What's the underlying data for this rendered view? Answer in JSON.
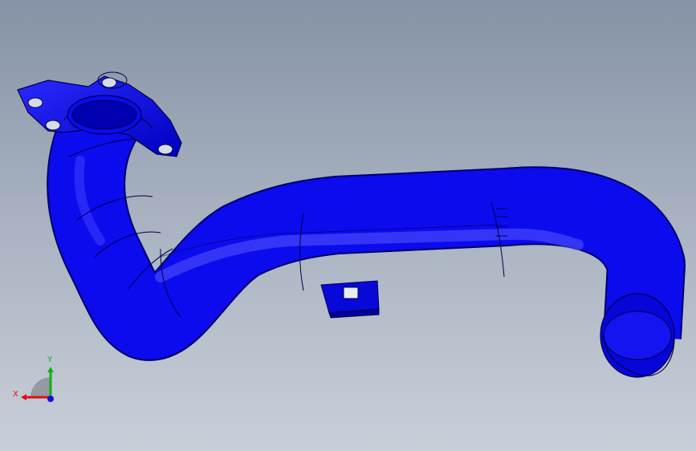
{
  "viewport": {
    "background_top": "#8593a6",
    "background_bottom": "#c9cfd9",
    "part_color": "#0a0af0",
    "edge_color": "#00004a"
  },
  "triad": {
    "x_label": "X",
    "y_label": "Y",
    "x_color": "#e01010",
    "y_color": "#10b010",
    "z_color": "#1010e0"
  }
}
